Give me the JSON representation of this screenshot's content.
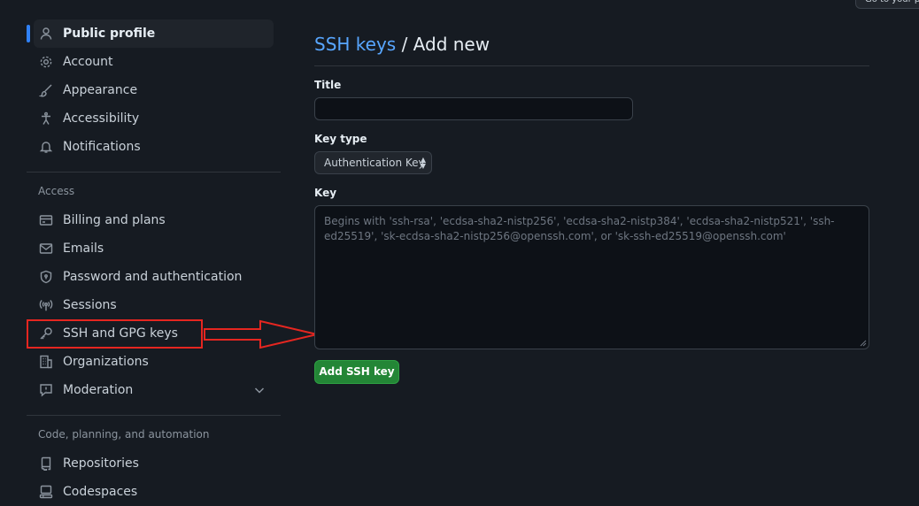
{
  "header": {
    "goto_label": "Go to your pe"
  },
  "sidebar": {
    "profile_items": [
      {
        "label": "Public profile",
        "icon": "person-icon"
      },
      {
        "label": "Account",
        "icon": "gear-icon"
      },
      {
        "label": "Appearance",
        "icon": "paintbrush-icon"
      },
      {
        "label": "Accessibility",
        "icon": "accessibility-icon"
      },
      {
        "label": "Notifications",
        "icon": "bell-icon"
      }
    ],
    "access_heading": "Access",
    "access_items": [
      {
        "label": "Billing and plans",
        "icon": "credit-card-icon"
      },
      {
        "label": "Emails",
        "icon": "mail-icon"
      },
      {
        "label": "Password and authentication",
        "icon": "shield-lock-icon"
      },
      {
        "label": "Sessions",
        "icon": "broadcast-icon"
      },
      {
        "label": "SSH and GPG keys",
        "icon": "key-icon"
      },
      {
        "label": "Organizations",
        "icon": "organization-icon"
      },
      {
        "label": "Moderation",
        "icon": "report-icon"
      }
    ],
    "code_heading": "Code, planning, and automation",
    "code_items": [
      {
        "label": "Repositories",
        "icon": "repo-icon"
      },
      {
        "label": "Codespaces",
        "icon": "codespaces-icon"
      }
    ]
  },
  "main": {
    "breadcrumb_link": "SSH keys",
    "breadcrumb_sep": " / ",
    "breadcrumb_current": "Add new",
    "title_label": "Title",
    "title_value": "",
    "key_type_label": "Key type",
    "key_type_value": "Authentication Key",
    "key_label": "Key",
    "key_placeholder": "Begins with 'ssh-rsa', 'ecdsa-sha2-nistp256', 'ecdsa-sha2-nistp384', 'ecdsa-sha2-nistp521', 'ssh-ed25519', 'sk-ecdsa-sha2-nistp256@openssh.com', or 'sk-ssh-ed25519@openssh.com'",
    "submit_label": "Add SSH key"
  },
  "colors": {
    "background": "#161b22",
    "link": "#58a6ff",
    "primary_button": "#238636",
    "annotation_red": "#e52620",
    "active_indicator": "#2f81f7"
  }
}
